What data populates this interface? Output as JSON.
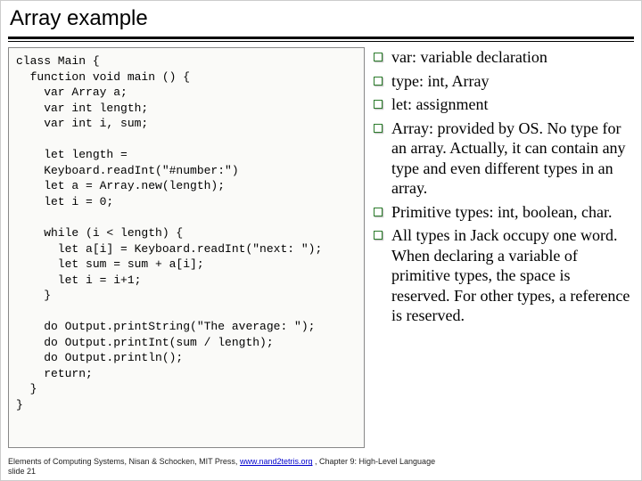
{
  "title": "Array example",
  "code": "class Main {\n  function void main () {\n    var Array a;\n    var int length;\n    var int i, sum;\n\n    let length =\n    Keyboard.readInt(\"#number:\")\n    let a = Array.new(length);\n    let i = 0;\n\n    while (i < length) {\n      let a[i] = Keyboard.readInt(\"next: \");\n      let sum = sum + a[i];\n      let i = i+1;\n    }\n\n    do Output.printString(\"The average: \");\n    do Output.printInt(sum / length);\n    do Output.println();\n    return;\n  }\n}",
  "bullets": [
    "var: variable declaration",
    "type: int, Array",
    "let: assignment",
    "Array: provided by OS. No type for an array. Actually, it can contain any type and even different types in an array.",
    "Primitive types: int, boolean, char.",
    "All types in Jack occupy one word. When declaring a variable of primitive types, the space is reserved. For other types, a reference is reserved."
  ],
  "footer": {
    "prefix": "Elements of Computing Systems, Nisan & Schocken, MIT Press, ",
    "link_text": "www.nand2tetris.org",
    "suffix": " , Chapter 9: High-Level Language",
    "line2": "slide 21"
  }
}
